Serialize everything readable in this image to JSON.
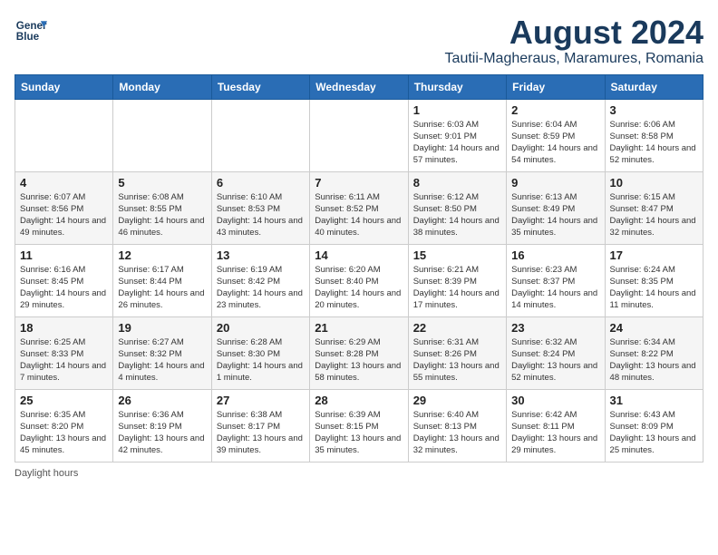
{
  "logo": {
    "line1": "General",
    "line2": "Blue"
  },
  "title": "August 2024",
  "subtitle": "Tautii-Magheraus, Maramures, Romania",
  "weekdays": [
    "Sunday",
    "Monday",
    "Tuesday",
    "Wednesday",
    "Thursday",
    "Friday",
    "Saturday"
  ],
  "footer": "Daylight hours",
  "weeks": [
    [
      {
        "day": "",
        "sunrise": "",
        "sunset": "",
        "daylight": ""
      },
      {
        "day": "",
        "sunrise": "",
        "sunset": "",
        "daylight": ""
      },
      {
        "day": "",
        "sunrise": "",
        "sunset": "",
        "daylight": ""
      },
      {
        "day": "",
        "sunrise": "",
        "sunset": "",
        "daylight": ""
      },
      {
        "day": "1",
        "sunrise": "Sunrise: 6:03 AM",
        "sunset": "Sunset: 9:01 PM",
        "daylight": "Daylight: 14 hours and 57 minutes."
      },
      {
        "day": "2",
        "sunrise": "Sunrise: 6:04 AM",
        "sunset": "Sunset: 8:59 PM",
        "daylight": "Daylight: 14 hours and 54 minutes."
      },
      {
        "day": "3",
        "sunrise": "Sunrise: 6:06 AM",
        "sunset": "Sunset: 8:58 PM",
        "daylight": "Daylight: 14 hours and 52 minutes."
      }
    ],
    [
      {
        "day": "4",
        "sunrise": "Sunrise: 6:07 AM",
        "sunset": "Sunset: 8:56 PM",
        "daylight": "Daylight: 14 hours and 49 minutes."
      },
      {
        "day": "5",
        "sunrise": "Sunrise: 6:08 AM",
        "sunset": "Sunset: 8:55 PM",
        "daylight": "Daylight: 14 hours and 46 minutes."
      },
      {
        "day": "6",
        "sunrise": "Sunrise: 6:10 AM",
        "sunset": "Sunset: 8:53 PM",
        "daylight": "Daylight: 14 hours and 43 minutes."
      },
      {
        "day": "7",
        "sunrise": "Sunrise: 6:11 AM",
        "sunset": "Sunset: 8:52 PM",
        "daylight": "Daylight: 14 hours and 40 minutes."
      },
      {
        "day": "8",
        "sunrise": "Sunrise: 6:12 AM",
        "sunset": "Sunset: 8:50 PM",
        "daylight": "Daylight: 14 hours and 38 minutes."
      },
      {
        "day": "9",
        "sunrise": "Sunrise: 6:13 AM",
        "sunset": "Sunset: 8:49 PM",
        "daylight": "Daylight: 14 hours and 35 minutes."
      },
      {
        "day": "10",
        "sunrise": "Sunrise: 6:15 AM",
        "sunset": "Sunset: 8:47 PM",
        "daylight": "Daylight: 14 hours and 32 minutes."
      }
    ],
    [
      {
        "day": "11",
        "sunrise": "Sunrise: 6:16 AM",
        "sunset": "Sunset: 8:45 PM",
        "daylight": "Daylight: 14 hours and 29 minutes."
      },
      {
        "day": "12",
        "sunrise": "Sunrise: 6:17 AM",
        "sunset": "Sunset: 8:44 PM",
        "daylight": "Daylight: 14 hours and 26 minutes."
      },
      {
        "day": "13",
        "sunrise": "Sunrise: 6:19 AM",
        "sunset": "Sunset: 8:42 PM",
        "daylight": "Daylight: 14 hours and 23 minutes."
      },
      {
        "day": "14",
        "sunrise": "Sunrise: 6:20 AM",
        "sunset": "Sunset: 8:40 PM",
        "daylight": "Daylight: 14 hours and 20 minutes."
      },
      {
        "day": "15",
        "sunrise": "Sunrise: 6:21 AM",
        "sunset": "Sunset: 8:39 PM",
        "daylight": "Daylight: 14 hours and 17 minutes."
      },
      {
        "day": "16",
        "sunrise": "Sunrise: 6:23 AM",
        "sunset": "Sunset: 8:37 PM",
        "daylight": "Daylight: 14 hours and 14 minutes."
      },
      {
        "day": "17",
        "sunrise": "Sunrise: 6:24 AM",
        "sunset": "Sunset: 8:35 PM",
        "daylight": "Daylight: 14 hours and 11 minutes."
      }
    ],
    [
      {
        "day": "18",
        "sunrise": "Sunrise: 6:25 AM",
        "sunset": "Sunset: 8:33 PM",
        "daylight": "Daylight: 14 hours and 7 minutes."
      },
      {
        "day": "19",
        "sunrise": "Sunrise: 6:27 AM",
        "sunset": "Sunset: 8:32 PM",
        "daylight": "Daylight: 14 hours and 4 minutes."
      },
      {
        "day": "20",
        "sunrise": "Sunrise: 6:28 AM",
        "sunset": "Sunset: 8:30 PM",
        "daylight": "Daylight: 14 hours and 1 minute."
      },
      {
        "day": "21",
        "sunrise": "Sunrise: 6:29 AM",
        "sunset": "Sunset: 8:28 PM",
        "daylight": "Daylight: 13 hours and 58 minutes."
      },
      {
        "day": "22",
        "sunrise": "Sunrise: 6:31 AM",
        "sunset": "Sunset: 8:26 PM",
        "daylight": "Daylight: 13 hours and 55 minutes."
      },
      {
        "day": "23",
        "sunrise": "Sunrise: 6:32 AM",
        "sunset": "Sunset: 8:24 PM",
        "daylight": "Daylight: 13 hours and 52 minutes."
      },
      {
        "day": "24",
        "sunrise": "Sunrise: 6:34 AM",
        "sunset": "Sunset: 8:22 PM",
        "daylight": "Daylight: 13 hours and 48 minutes."
      }
    ],
    [
      {
        "day": "25",
        "sunrise": "Sunrise: 6:35 AM",
        "sunset": "Sunset: 8:20 PM",
        "daylight": "Daylight: 13 hours and 45 minutes."
      },
      {
        "day": "26",
        "sunrise": "Sunrise: 6:36 AM",
        "sunset": "Sunset: 8:19 PM",
        "daylight": "Daylight: 13 hours and 42 minutes."
      },
      {
        "day": "27",
        "sunrise": "Sunrise: 6:38 AM",
        "sunset": "Sunset: 8:17 PM",
        "daylight": "Daylight: 13 hours and 39 minutes."
      },
      {
        "day": "28",
        "sunrise": "Sunrise: 6:39 AM",
        "sunset": "Sunset: 8:15 PM",
        "daylight": "Daylight: 13 hours and 35 minutes."
      },
      {
        "day": "29",
        "sunrise": "Sunrise: 6:40 AM",
        "sunset": "Sunset: 8:13 PM",
        "daylight": "Daylight: 13 hours and 32 minutes."
      },
      {
        "day": "30",
        "sunrise": "Sunrise: 6:42 AM",
        "sunset": "Sunset: 8:11 PM",
        "daylight": "Daylight: 13 hours and 29 minutes."
      },
      {
        "day": "31",
        "sunrise": "Sunrise: 6:43 AM",
        "sunset": "Sunset: 8:09 PM",
        "daylight": "Daylight: 13 hours and 25 minutes."
      }
    ]
  ]
}
